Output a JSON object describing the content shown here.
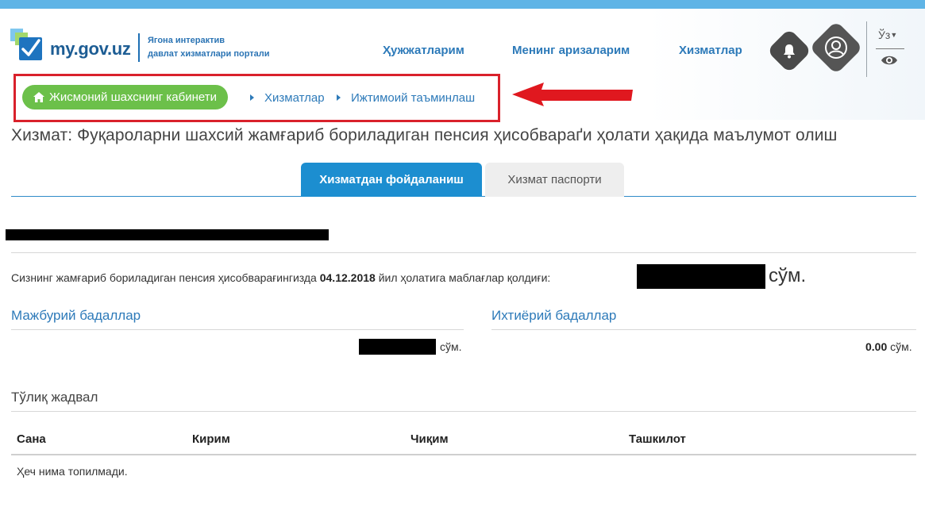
{
  "header": {
    "logo_text": "my.gov.uz",
    "logo_tagline_line1": "Ягона интерактив",
    "logo_tagline_line2": "давлат хизматлари портали",
    "nav": [
      {
        "label": "Ҳужжатларим"
      },
      {
        "label": "Менинг аризаларим"
      },
      {
        "label": "Хизматлар"
      }
    ],
    "language": "Ўз",
    "icons": {
      "notifications": "bell-icon",
      "profile": "user-icon",
      "accessibility": "eye-icon"
    }
  },
  "breadcrumb": {
    "home_label": "Жисмоний шахснинг кабинети",
    "items": [
      {
        "label": "Хизматлар"
      },
      {
        "label": "Ижтимоий таъминлаш"
      }
    ]
  },
  "page": {
    "title": "Хизмат: Фуқароларни шахсий жамғариб бориладиган пенсия ҳисобвараґи ҳолати ҳақида маълумот олиш"
  },
  "tabs": [
    {
      "label": "Хизматдан фойдаланиш",
      "active": true
    },
    {
      "label": "Хизмат паспорти",
      "active": false
    }
  ],
  "balance": {
    "prefix": "Сизнинг жамғариб бориладиган пенсия ҳисобварағингизда",
    "date": "04.12.2018",
    "suffix": "йил ҳолатига маблағлар қолдиғи:",
    "currency": "сўм."
  },
  "contributions": {
    "mandatory_title": "Мажбурий бадаллар",
    "mandatory_currency": "сўм.",
    "voluntary_title": "Ихтиёрий бадаллар",
    "voluntary_amount": "0.00",
    "voluntary_currency": "сўм."
  },
  "table": {
    "title": "Тўлиқ жадвал",
    "columns": [
      "Сана",
      "Кирим",
      "Чиқим",
      "Ташкилот"
    ],
    "empty_message": "Ҳеч нима топилмади."
  },
  "colors": {
    "accent": "#1c8ed0",
    "link": "#2d7ab9",
    "breadcrumb_home": "#6cc04a",
    "highlight_frame": "#d9212b"
  }
}
